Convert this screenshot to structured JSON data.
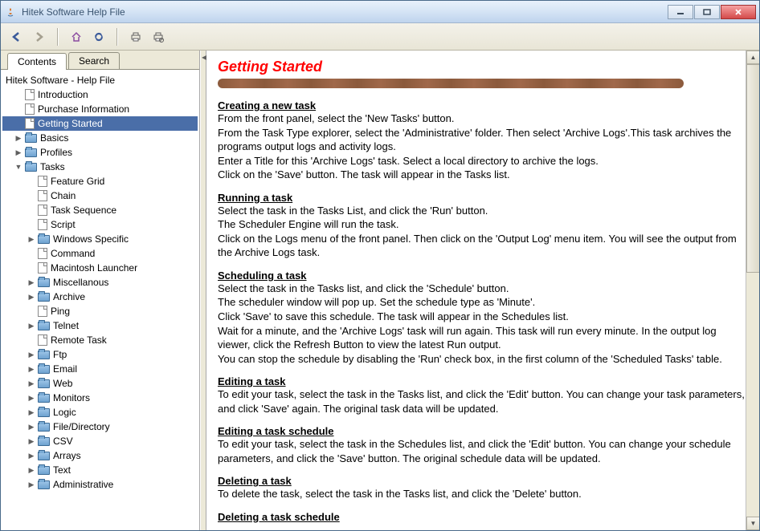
{
  "window": {
    "title": "Hitek Software Help File"
  },
  "tabs": {
    "contents": "Contents",
    "search": "Search"
  },
  "tree": {
    "root": "Hitek Software - Help File",
    "introduction": "Introduction",
    "purchase": "Purchase Information",
    "getting_started": "Getting Started",
    "basics": "Basics",
    "profiles": "Profiles",
    "tasks": "Tasks",
    "feature_grid": "Feature Grid",
    "chain": "Chain",
    "task_sequence": "Task Sequence",
    "script": "Script",
    "windows_specific": "Windows Specific",
    "command": "Command",
    "mac_launcher": "Macintosh Launcher",
    "misc": "Miscellanous",
    "archive": "Archive",
    "ping": "Ping",
    "telnet": "Telnet",
    "remote_task": "Remote Task",
    "ftp": "Ftp",
    "email": "Email",
    "web": "Web",
    "monitors": "Monitors",
    "logic": "Logic",
    "file_directory": "File/Directory",
    "csv": "CSV",
    "arrays": "Arrays",
    "text": "Text",
    "administrative": "Administrative"
  },
  "content": {
    "title": "Getting Started",
    "sec1_head": "Creating a new task",
    "sec1_l1": "From the front panel, select the 'New Tasks' button.",
    "sec1_l2": "From the Task Type explorer, select the 'Administrative' folder. Then select 'Archive Logs'.This task archives the programs output logs and activity logs.",
    "sec1_l3": "Enter a Title for this 'Archive Logs' task. Select a local directory to archive the logs.",
    "sec1_l4": "Click on the 'Save' button.  The task will appear in the Tasks list.",
    "sec2_head": "Running a task",
    "sec2_l1": "Select the task in the Tasks List, and click the 'Run' button.",
    "sec2_l2": "The Scheduler Engine will run the task.",
    "sec2_l3": "Click on the Logs menu of the front panel. Then click on the 'Output Log' menu item. You will see the output from the Archive Logs task.",
    "sec3_head": "Scheduling a task",
    "sec3_l1": "Select the task in the Tasks list, and click the 'Schedule' button.",
    "sec3_l2": "The scheduler window will pop up. Set the schedule type as 'Minute'.",
    "sec3_l3": "Click 'Save' to save this schedule.  The task will appear in the Schedules list.",
    "sec3_l4": "Wait for a minute, and the 'Archive Logs' task will run again.  This task will run every minute. In the output log viewer, click the Refresh Button to view the latest Run output.",
    "sec3_l5": "You can stop the schedule by disabling the 'Run' check box, in the first column of the 'Scheduled Tasks' table.",
    "sec4_head": "Editing a task",
    "sec4_l1": "To edit your task, select the task in the Tasks list, and click the 'Edit' button. You can change your task parameters, and click 'Save' again.  The original task data will be updated.",
    "sec5_head": "Editing a task schedule",
    "sec5_l1": "To edit your task, select the task in the Schedules list, and click the 'Edit' button. You can change your schedule parameters, and click the 'Save' button.  The original schedule data will be updated.",
    "sec6_head": "Deleting a task",
    "sec6_l1": "To delete the task, select the task in the Tasks list, and click the 'Delete' button.",
    "sec7_head": "Deleting a task schedule"
  }
}
